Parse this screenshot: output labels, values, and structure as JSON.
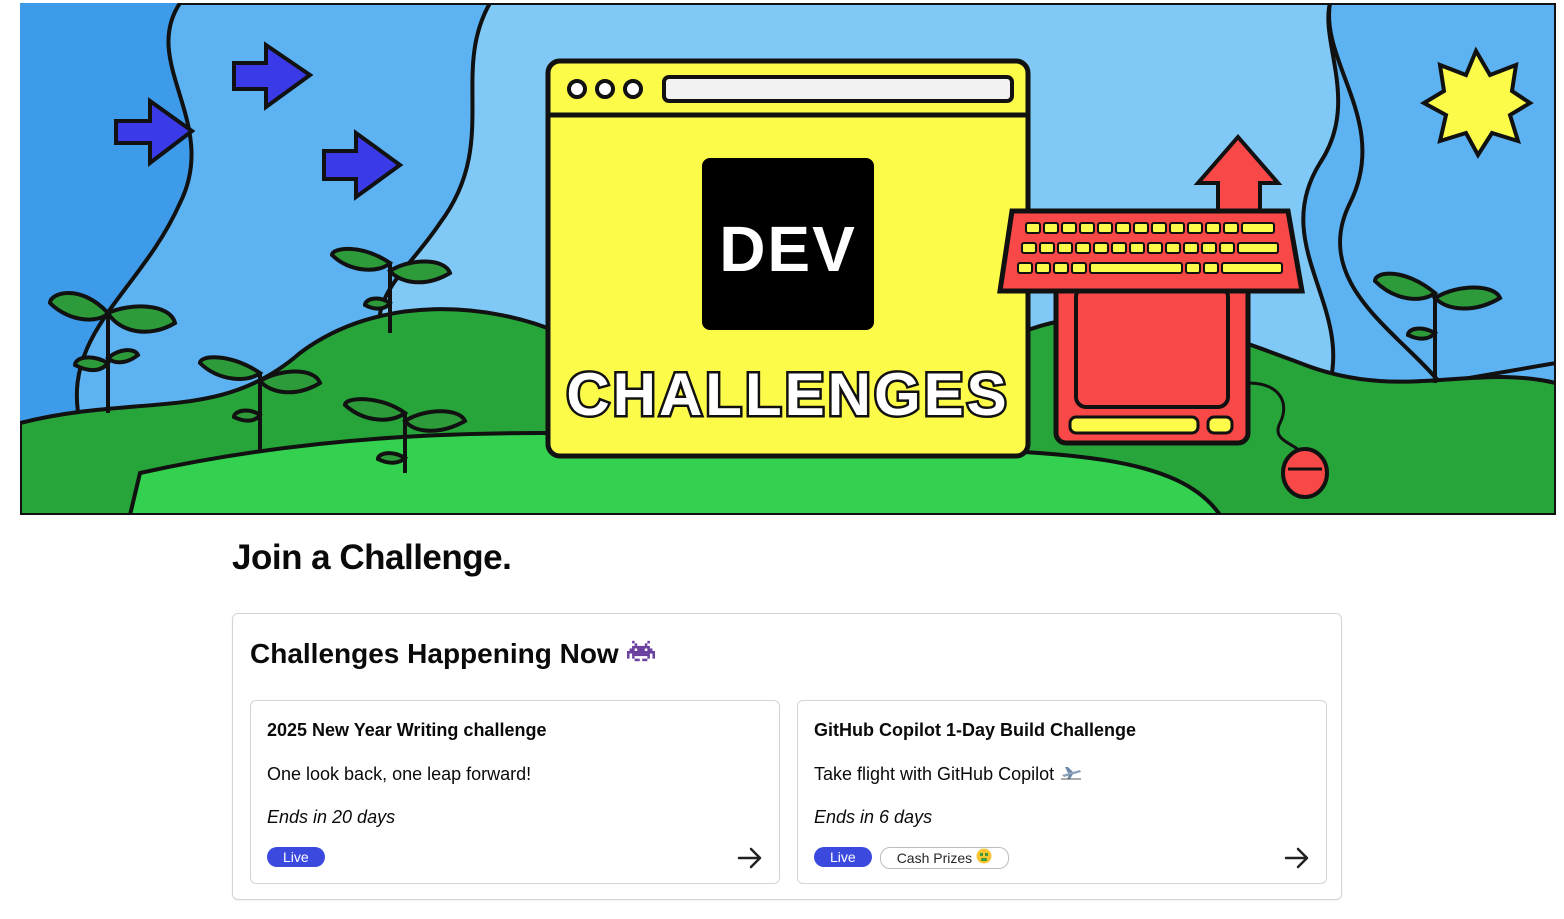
{
  "banner": {
    "logo_text": "DEV",
    "banner_text": "CHALLENGES"
  },
  "page": {
    "heading": "Join a Challenge."
  },
  "panel": {
    "title": "Challenges Happening Now",
    "title_icon": "space-invader-icon"
  },
  "challenges": [
    {
      "title": "2025 New Year Writing challenge",
      "description": "One look back, one leap forward!",
      "ends": "Ends in 20 days",
      "tags": [
        "Live"
      ]
    },
    {
      "title": "GitHub Copilot 1-Day Build Challenge",
      "description": "Take flight with GitHub Copilot",
      "description_icon": "airplane-icon",
      "ends": "Ends in 6 days",
      "tags": [
        "Live",
        "Cash Prizes"
      ],
      "tag_icon": "money-face-icon"
    }
  ],
  "colors": {
    "live_tag": "#3b49df",
    "banner_sky": "#7cc4f5",
    "banner_grass": "#33d14f",
    "banner_yellow": "#fdfb4a",
    "banner_red": "#f94848"
  }
}
